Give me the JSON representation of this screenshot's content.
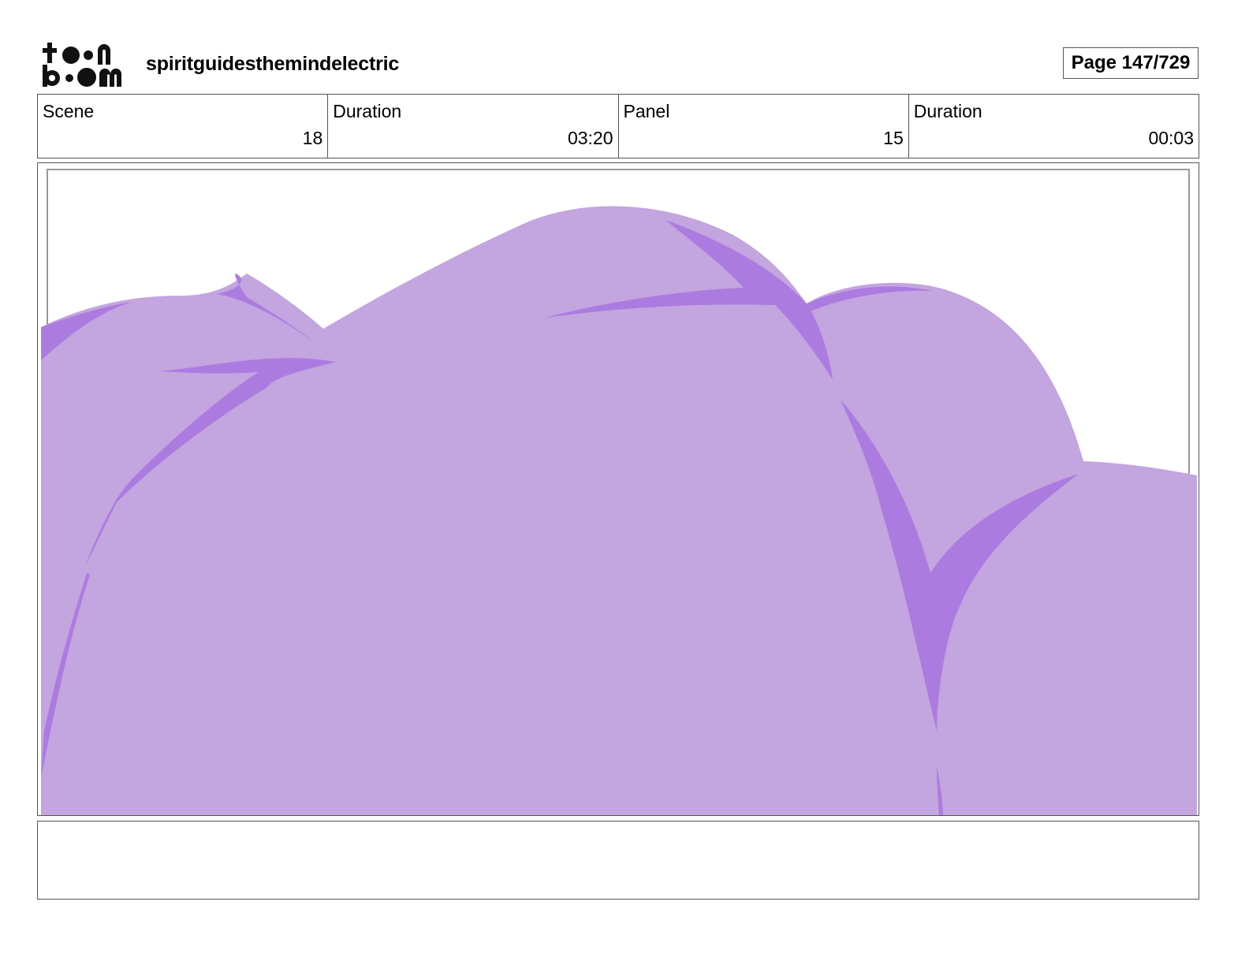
{
  "header": {
    "logo_text": "toon boom",
    "project_title": "spiritguidesthemindelectric",
    "page_label": "Page 147/729"
  },
  "info": [
    {
      "label": "Scene",
      "value": "18"
    },
    {
      "label": "Duration",
      "value": "03:20"
    },
    {
      "label": "Panel",
      "value": "15"
    },
    {
      "label": "Duration",
      "value": "00:03"
    }
  ],
  "panel": {
    "fill_color": "#c3a5df",
    "stroke_color": "#ac7be0"
  },
  "notes": {
    "text": ""
  }
}
